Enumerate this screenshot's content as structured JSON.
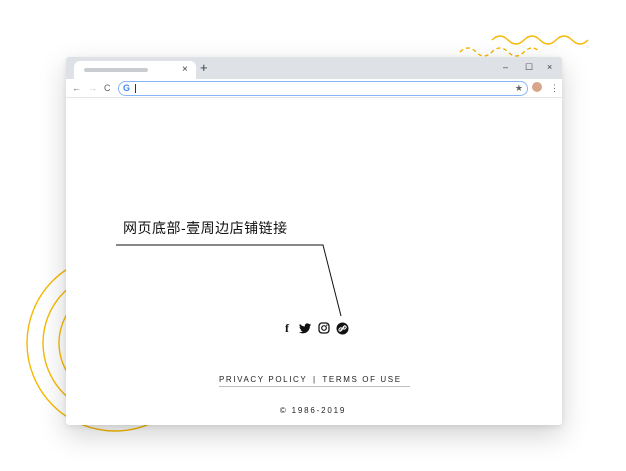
{
  "browser": {
    "tab_close": "×",
    "new_tab": "+",
    "window_controls": {
      "minimize": "–",
      "maximize": "☐",
      "close": "×"
    },
    "nav": {
      "back": "←",
      "forward": "→",
      "reload": "C"
    },
    "omnibox": {
      "provider_icon": "G",
      "value": ""
    },
    "bookmark_star": "★",
    "menu": "⋮"
  },
  "annotation": {
    "label": "网页底部-壹周边店铺链接"
  },
  "footer": {
    "social_icons": [
      "facebook-icon",
      "twitter-icon",
      "instagram-icon",
      "link-icon"
    ],
    "links": {
      "privacy": "PRIVACY POLICY",
      "separator": "|",
      "terms": "TERMS OF USE"
    },
    "copyright": "© 1986-2019"
  },
  "colors": {
    "accent": "#f5b800",
    "text": "#111111"
  }
}
